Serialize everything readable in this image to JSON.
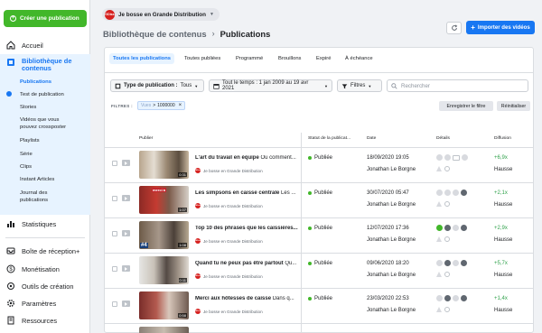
{
  "sidebar": {
    "create_label": "Créer une publication",
    "items": [
      {
        "label": "Accueil",
        "icon": "home-icon"
      },
      {
        "label": "Bibliothèque de contenus",
        "icon": "library-icon"
      },
      {
        "label": "Statistiques",
        "icon": "chart-icon"
      },
      {
        "label": "Boîte de réception+",
        "icon": "inbox-icon"
      },
      {
        "label": "Monétisation",
        "icon": "money-icon"
      },
      {
        "label": "Outils de création",
        "icon": "tools-icon"
      },
      {
        "label": "Paramètres",
        "icon": "gear-icon"
      },
      {
        "label": "Ressources",
        "icon": "resources-icon"
      }
    ],
    "library_line1": "Bibliothèque de",
    "library_line2": "contenus",
    "sub_items": [
      "Publications",
      "Test de publication",
      "Stories",
      "Vidéos que vous",
      "pouvez crossposter",
      "Playlists",
      "Série",
      "Clips",
      "Instant Articles",
      "Journal des",
      "publications"
    ]
  },
  "header": {
    "page_name": "Je bosse en Grande Distribution",
    "page_logo_text": "GDiss",
    "breadcrumb_parent": "Bibliothèque de contenus",
    "breadcrumb_current": "Publications",
    "import_label": "Importer des vidéos"
  },
  "tabs": [
    "Toutes les publications",
    "Toutes publiées",
    "Programmé",
    "Brouillons",
    "Expiré",
    "À échéance"
  ],
  "filters": {
    "type_label": "Type de publication :",
    "type_value": "Tous",
    "time_label": "Tout le temps : 1 jan 2009 au 19 avr 2021",
    "filters_label": "Filtres",
    "search_placeholder": "Rechercher",
    "active_label": "FILTRES :",
    "chip_key": "Vues",
    "chip_op": ">",
    "chip_value": "1000000",
    "save_label": "Enregistrer le filtre",
    "reset_label": "Réinitialiser"
  },
  "table": {
    "columns": [
      "Publier",
      "Statut de la publicat...",
      "Date",
      "Détails",
      "Diffusion"
    ],
    "rows": [
      {
        "title_bold": "L'art du travail en équipe",
        "title_rest": " Ou comment...",
        "page": "Je bosse en Grande Distribution",
        "status": "Publiée",
        "date": "18/09/2020 19:05",
        "author": "Jonathan Le Borgne",
        "diffusion": "+6,9x",
        "diffusion_label": "Hausse",
        "duration": "0:31"
      },
      {
        "title_bold": "Les simpsons en caisse centrale",
        "title_rest": " Les ...",
        "page": "Je bosse en Grande Distribution",
        "status": "Publiée",
        "date": "30/07/2020 05:47",
        "author": "Jonathan Le Borgne",
        "diffusion": "+2,1x",
        "diffusion_label": "Hausse",
        "duration": "1:07",
        "tag": "merci à"
      },
      {
        "title_bold": "Top 10 des phrases que les caissières...",
        "title_rest": "",
        "page": "Je bosse en Grande Distribution",
        "status": "Publiée",
        "date": "12/07/2020 17:36",
        "author": "Jonathan Le Borgne",
        "diffusion": "+2,9x",
        "diffusion_label": "Hausse",
        "duration": "1:08",
        "num": "#4"
      },
      {
        "title_bold": "Quand tu ne peux pas être partout",
        "title_rest": " Qu...",
        "page": "Je bosse en Grande Distribution",
        "status": "Publiée",
        "date": "09/06/2020 18:20",
        "author": "Jonathan Le Borgne",
        "diffusion": "+5,7x",
        "diffusion_label": "Hausse",
        "duration": "0:11"
      },
      {
        "title_bold": "Merci aux hôtesses de caisse",
        "title_rest": " Dans q...",
        "page": "Je bosse en Grande Distribution",
        "status": "Publiée",
        "date": "23/03/2020 22:53",
        "author": "Jonathan Le Borgne",
        "diffusion": "+1,4x",
        "diffusion_label": "Hausse",
        "duration": "0:58"
      }
    ]
  },
  "colors": {
    "accent": "#1877f2",
    "create": "#42b72a",
    "published": "#42b72a",
    "diffusion": "#31a24c",
    "logo": "#d6211f"
  }
}
